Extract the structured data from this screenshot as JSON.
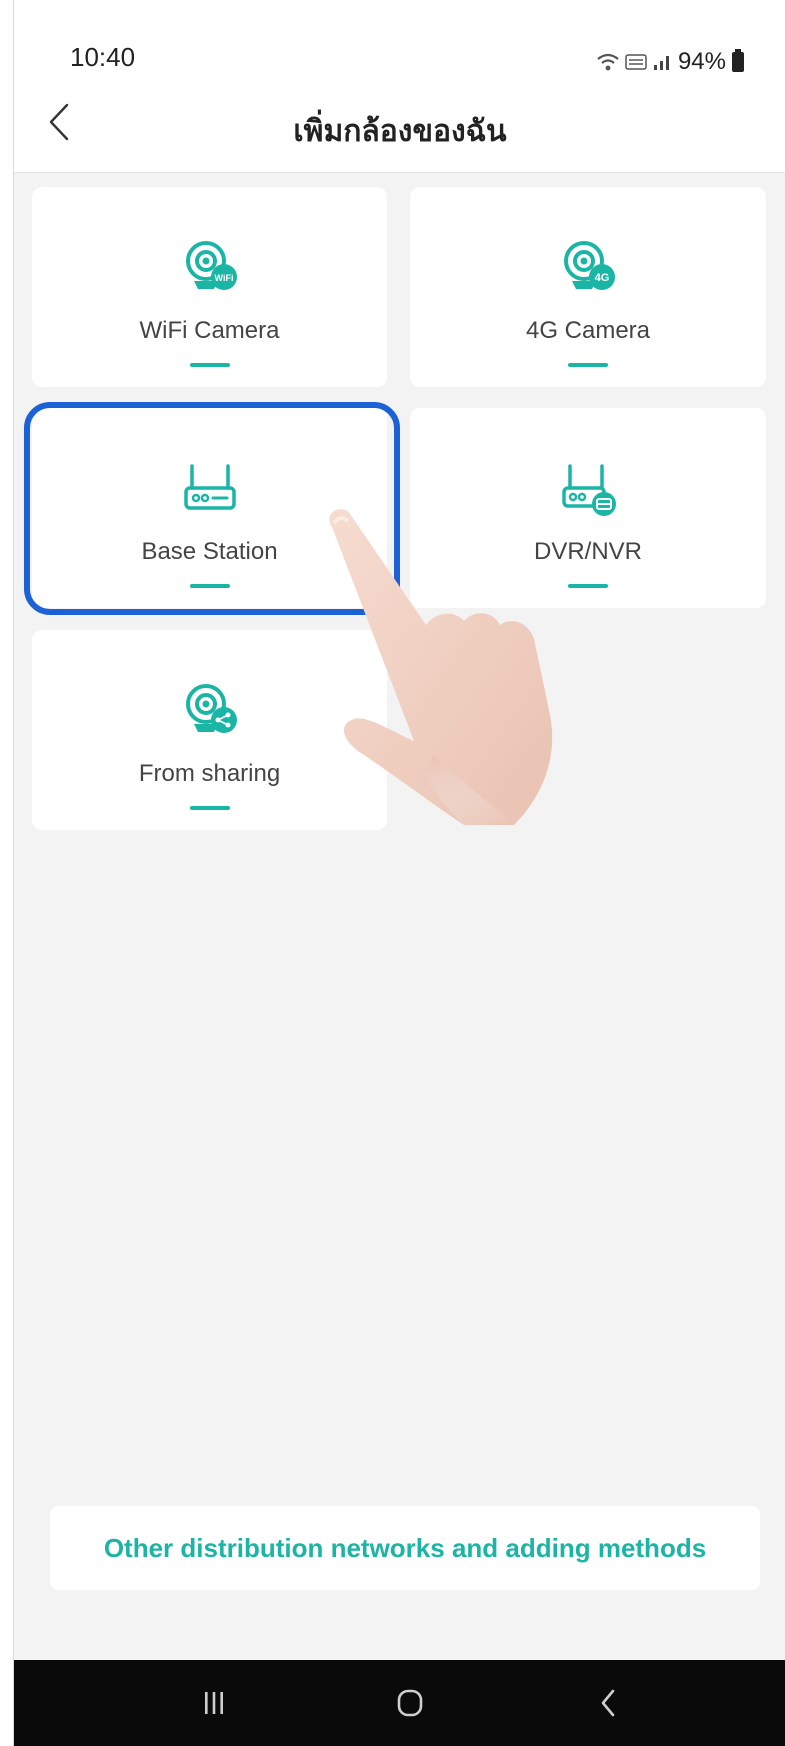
{
  "status_bar": {
    "time": "10:40",
    "battery": "94%"
  },
  "header": {
    "title": "เพิ่มกล้องของฉัน",
    "back_icon": "chevron-left-icon"
  },
  "devices": [
    {
      "label": "WiFi Camera",
      "icon": "wifi-camera-icon",
      "badge": "WiFi"
    },
    {
      "label": "4G Camera",
      "icon": "4g-camera-icon",
      "badge": "4G"
    },
    {
      "label": "Base Station",
      "icon": "base-station-icon"
    },
    {
      "label": "DVR/NVR",
      "icon": "dvr-nvr-icon"
    },
    {
      "label": "From sharing",
      "icon": "share-camera-icon"
    }
  ],
  "other_methods": {
    "label": "Other distribution networks and adding methods"
  },
  "navbar": {
    "recent_icon": "recent-apps-icon",
    "home_icon": "home-icon",
    "back_icon": "back-icon"
  },
  "colors": {
    "accent": "#1bb5a6",
    "highlight": "#1c62d6",
    "background": "#f3f3f3"
  }
}
